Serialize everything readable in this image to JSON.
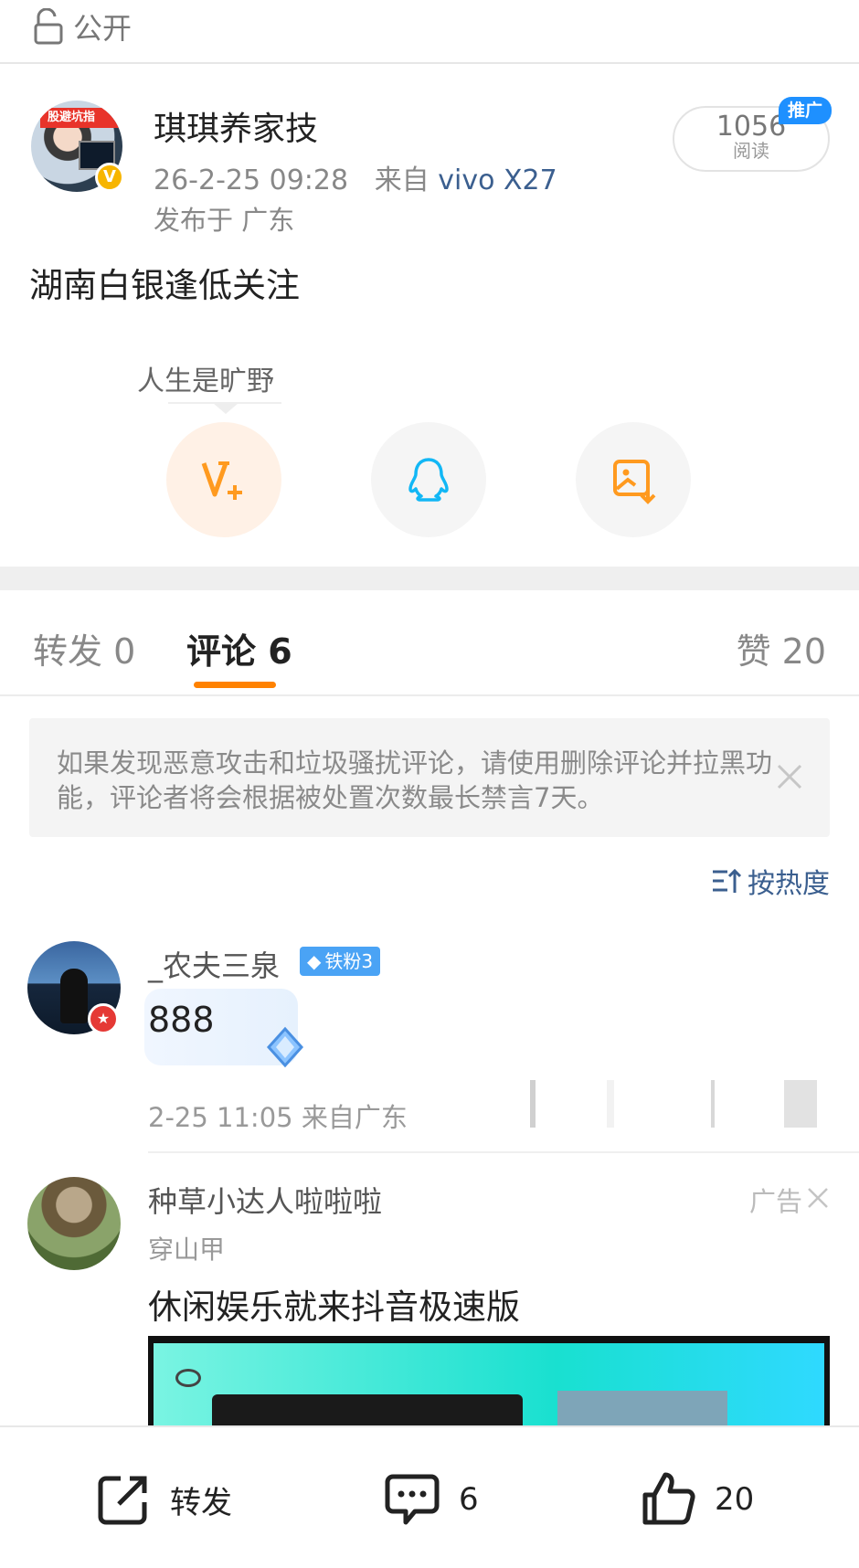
{
  "visibility": {
    "label": "公开",
    "icon": "lock-icon"
  },
  "post": {
    "author": "琪琪养家技",
    "avatar_caption": "股避坑指",
    "verified_badge": "V",
    "datetime": "26-2-25 09:28",
    "source_prefix": "来自",
    "device": "vivo X27",
    "location": "发布于 广东",
    "read_count": "1056",
    "read_label": "阅读",
    "promo_badge": "推广",
    "text": "湖南白银逢低关注"
  },
  "share": {
    "tooltip": "人生是旷野",
    "buttons": [
      {
        "name": "vplus-icon"
      },
      {
        "name": "qq-icon"
      },
      {
        "name": "save-image-icon"
      }
    ]
  },
  "tabs": {
    "repost": "转发 0",
    "comments": "评论 6",
    "likes": "赞 20",
    "active": "comments",
    "accent": "#ff8200"
  },
  "notice": {
    "text": "如果发现恶意攻击和垃圾骚扰评论，请使用删除评论并拉黑功能，评论者将会根据被处置次数最长禁言7天。"
  },
  "sort_label": "按热度",
  "comments": [
    {
      "user": "_农夫三泉",
      "fan_badge": "铁粉3",
      "text": "888",
      "time": "2-25 11:05",
      "location": "来自广东"
    }
  ],
  "ad": {
    "user": "种草小达人啦啦啦",
    "tag": "广告",
    "subtitle": "穿山甲",
    "text": "休闲娱乐就来抖音极速版"
  },
  "bottom_bar": {
    "repost_label": "转发",
    "comment_count": "6",
    "like_count": "20"
  }
}
